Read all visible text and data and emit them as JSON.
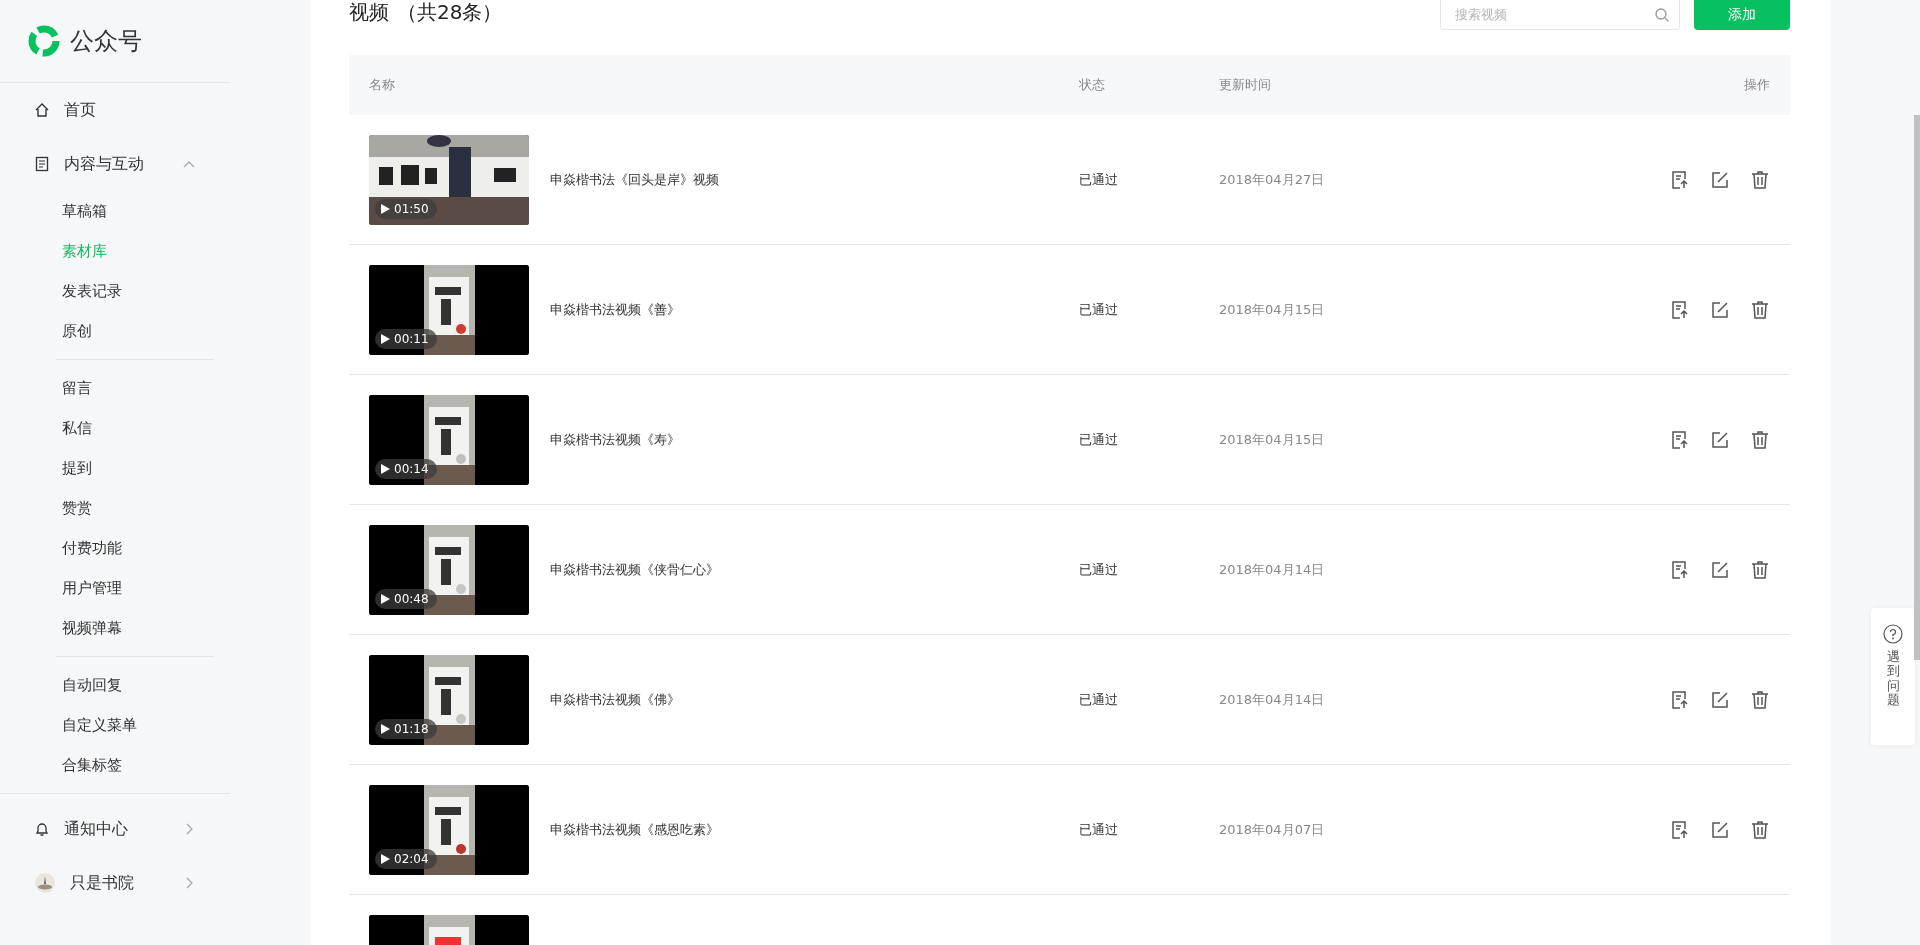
{
  "sidebar": {
    "logo": "公众号",
    "nav": [
      {
        "kind": "home",
        "label": "首页"
      },
      {
        "kind": "content",
        "label": "内容与互动",
        "expanded": true,
        "sections": [
          [
            {
              "label": "草稿箱",
              "selected": false
            },
            {
              "label": "素材库",
              "selected": true
            },
            {
              "label": "发表记录",
              "selected": false
            },
            {
              "label": "原创",
              "selected": false
            }
          ],
          [
            {
              "label": "留言",
              "selected": false
            },
            {
              "label": "私信",
              "selected": false
            },
            {
              "label": "提到",
              "selected": false
            },
            {
              "label": "赞赏",
              "selected": false
            },
            {
              "label": "付费功能",
              "selected": false
            },
            {
              "label": "用户管理",
              "selected": false
            },
            {
              "label": "视频弹幕",
              "selected": false
            }
          ],
          [
            {
              "label": "自动回复",
              "selected": false
            },
            {
              "label": "自定义菜单",
              "selected": false
            },
            {
              "label": "合集标签",
              "selected": false
            }
          ]
        ]
      },
      {
        "kind": "notice",
        "label": "通知中心",
        "expanded": false
      },
      {
        "kind": "account",
        "label": "只是书院",
        "expanded": false
      }
    ]
  },
  "header": {
    "title": "视频",
    "count": "（共28条）",
    "search": {
      "placeholder": "搜索视频"
    },
    "add_button": "添加"
  },
  "table": {
    "columns": [
      "名称",
      "状态",
      "更新时间",
      "操作"
    ],
    "rows": [
      {
        "kind": "video",
        "duration": "01:50",
        "title": "申焱楷书法《回头是岸》视频",
        "status": "已通过",
        "updated": "2018年04月27日"
      },
      {
        "kind": "video",
        "duration": "00:11",
        "title": "申焱楷书法视频《善》",
        "status": "已通过",
        "updated": "2018年04月15日"
      },
      {
        "kind": "video",
        "duration": "00:14",
        "title": "申焱楷书法视频《寿》",
        "status": "已通过",
        "updated": "2018年04月15日"
      },
      {
        "kind": "video",
        "duration": "00:48",
        "title": "申焱楷书法视频《侠骨仁心》",
        "status": "已通过",
        "updated": "2018年04月14日"
      },
      {
        "kind": "video",
        "duration": "01:18",
        "title": "申焱楷书法视频《佛》",
        "status": "已通过",
        "updated": "2018年04月14日"
      },
      {
        "kind": "video",
        "duration": "02:04",
        "title": "申焱楷书法视频《感恩吃素》",
        "status": "已通过",
        "updated": "2018年04月07日"
      },
      {
        "kind": "cut"
      }
    ]
  },
  "help": {
    "label": "遇到问题"
  }
}
